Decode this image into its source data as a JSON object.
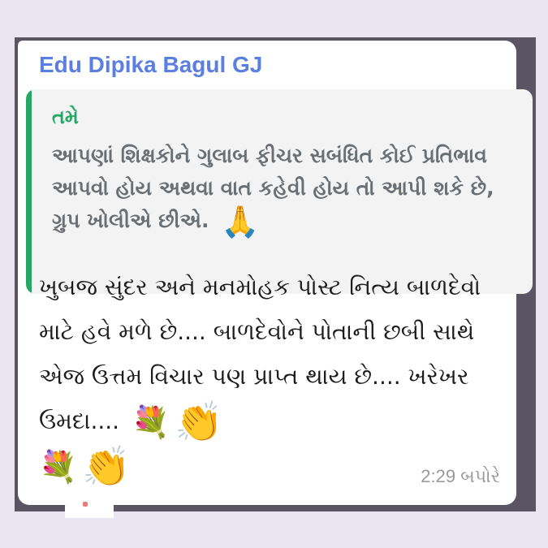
{
  "message": {
    "sender": "Edu Dipika Bagul GJ",
    "quoted": {
      "author": "તમે",
      "text": "આપણાં શિક્ષકોને ગુલાબ ફીચર સબંધિત કોઈ પ્રતિભાવ આપવો હોય અથવા વાત કહેવી હોય તો આપી શકે છે, ગ્રુપ ખોલીએ છીએ.",
      "emoji": "🙏"
    },
    "body": "ખુબજ સુંદર અને મનમોહક પોસ્ટ નિત્ય બાળદેવો માટે હવે મળે છે.... બાળદેવોને પોતાની છબી સાથે એજ ઉત્તમ વિચાર પણ પ્રાપ્ત થાય છે.... ખરેખર ઉમદા....",
    "emojis": [
      "💐",
      "👏",
      "💐",
      "👏"
    ],
    "time": "2:29 બપોરે"
  },
  "colors": {
    "sender_name": "#5b7fe0",
    "quote_accent": "#25a766",
    "quote_background": "#f3f3f3",
    "page_background": "#e9e6f1"
  }
}
